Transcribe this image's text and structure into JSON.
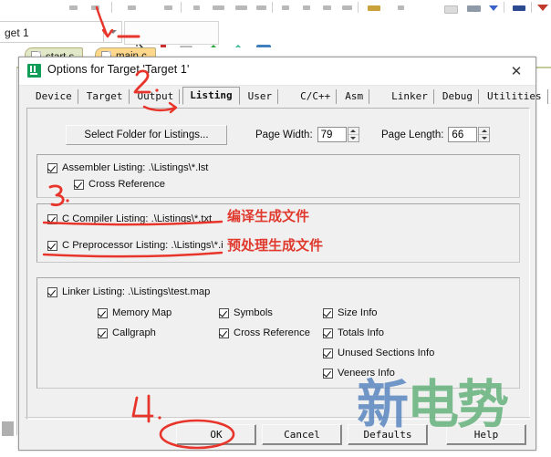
{
  "toolbar": {
    "target_value": "get 1",
    "dropdown_icon": "chevron-down-icon",
    "icons": [
      "build-target-icon",
      "build-all-icon",
      "batch-build-icon",
      "translate-icon",
      "options-target-icon",
      "manage-runtime-icon"
    ]
  },
  "editor_tabs": [
    {
      "label": "start.s",
      "active": false
    },
    {
      "label": "main.c",
      "active": true
    }
  ],
  "dialog": {
    "title": "Options for Target 'Target 1'",
    "app_icon": "keil-uvision-icon",
    "close_icon": "close-icon",
    "tabs": [
      {
        "label": "Device",
        "selected": false
      },
      {
        "label": "Target",
        "selected": false
      },
      {
        "label": "Output",
        "selected": false
      },
      {
        "label": "Listing",
        "selected": true
      },
      {
        "label": "User",
        "selected": false
      },
      {
        "label": "C/C++",
        "selected": false
      },
      {
        "label": "Asm",
        "selected": false
      },
      {
        "label": "Linker",
        "selected": false
      },
      {
        "label": "Debug",
        "selected": false
      },
      {
        "label": "Utilities",
        "selected": false
      }
    ],
    "select_folder_button": "Select Folder for Listings...",
    "page_width": {
      "label": "Page Width:",
      "value": "79"
    },
    "page_length": {
      "label": "Page Length:",
      "value": "66"
    },
    "group_assembler": [
      {
        "label": "Assembler Listing:  .\\Listings\\*.lst",
        "checked": true,
        "indent": 0
      },
      {
        "label": "Cross Reference",
        "checked": true,
        "indent": 1
      }
    ],
    "group_compiler": [
      {
        "label": "C Compiler Listing:  .\\Listings\\*.txt",
        "checked": true
      },
      {
        "label": "C Preprocessor Listing:  .\\Listings\\*.i",
        "checked": true
      }
    ],
    "group_linker": {
      "header": {
        "label": "Linker Listing:  .\\Listings\\test.map",
        "checked": true
      },
      "col1": [
        {
          "label": "Memory Map",
          "checked": true
        },
        {
          "label": "Callgraph",
          "checked": true
        }
      ],
      "col2": [
        {
          "label": "Symbols",
          "checked": true
        },
        {
          "label": "Cross Reference",
          "checked": true
        }
      ],
      "col3": [
        {
          "label": "Size Info",
          "checked": true
        },
        {
          "label": "Totals Info",
          "checked": true
        },
        {
          "label": "Unused Sections Info",
          "checked": true
        },
        {
          "label": "Veneers Info",
          "checked": true
        }
      ]
    },
    "buttons": {
      "ok": "OK",
      "cancel": "Cancel",
      "defaults": "Defaults",
      "help": "Help"
    }
  },
  "annotations": {
    "compiler_note": "编译生成文件",
    "preprocessor_note": "预处理生成文件",
    "step2": "2.",
    "step3": "3.",
    "step4": "4.",
    "ink_color": "#e8352b"
  },
  "watermark": {
    "char1": "新",
    "chars23": "电势",
    "color1": "#4a7cba",
    "color23": "#5dae74"
  }
}
